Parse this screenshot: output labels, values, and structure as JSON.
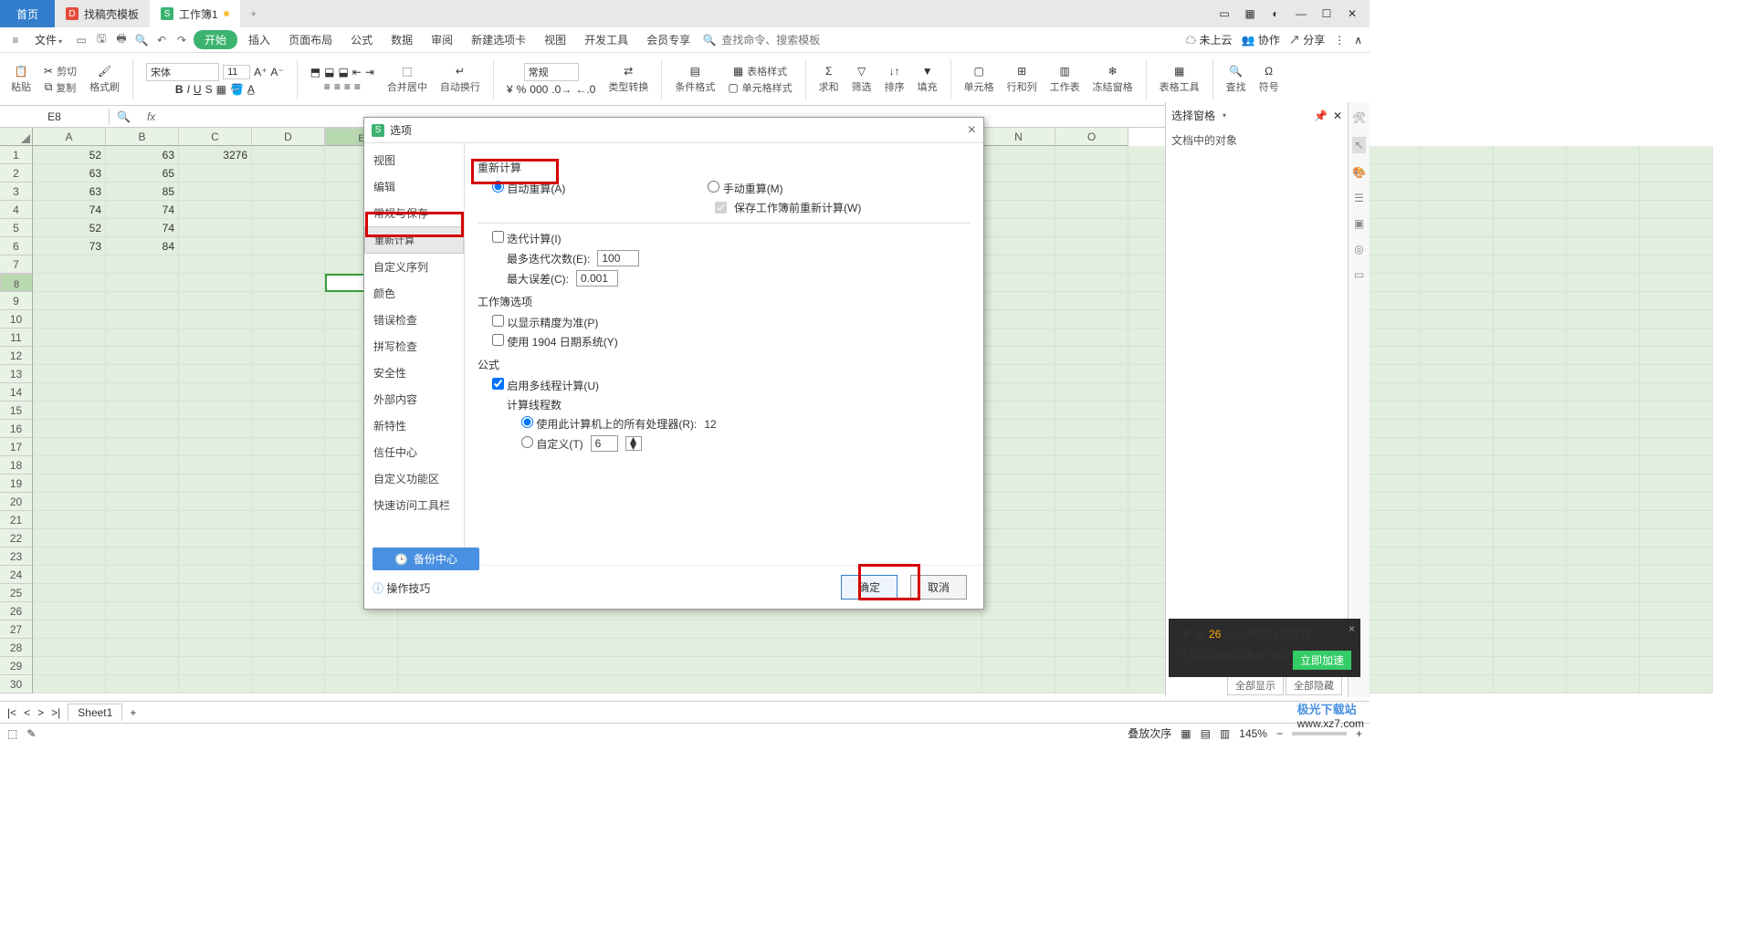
{
  "tabs": {
    "home": "首页",
    "templates": "找稿壳模板",
    "workbook": "工作簿1"
  },
  "menu": {
    "file": "文件",
    "start": "开始",
    "insert": "插入",
    "layout": "页面布局",
    "formula": "公式",
    "data": "数据",
    "review": "审阅",
    "newtab": "新建选项卡",
    "view": "视图",
    "dev": "开发工具",
    "member": "会员专享",
    "search_ph": "查找命令、搜索模板"
  },
  "topright": {
    "cloud": "未上云",
    "collab": "协作",
    "share": "分享"
  },
  "ribbon": {
    "paste": "粘贴",
    "cut": "剪切",
    "copy": "复制",
    "format": "格式刷",
    "font": "宋体",
    "size": "11",
    "merge": "合并居中",
    "wrap": "自动换行",
    "general": "常规",
    "convert": "类型转换",
    "cond": "条件格式",
    "tablestyle": "表格样式",
    "cellstyle": "单元格样式",
    "sum": "求和",
    "filter": "筛选",
    "sort": "排序",
    "fill": "填充",
    "cell": "单元格",
    "rowcol": "行和列",
    "worksheet": "工作表",
    "freeze": "冻结窗格",
    "tabletool": "表格工具",
    "find": "查找",
    "symbol": "符号"
  },
  "namebox": "E8",
  "fx": "fx",
  "cols": [
    "A",
    "B",
    "C",
    "D",
    "E",
    "N",
    "O"
  ],
  "cells": {
    "a": [
      "52",
      "63",
      "63",
      "74",
      "52",
      "73"
    ],
    "b": [
      "63",
      "65",
      "85",
      "74",
      "74",
      "84"
    ],
    "c1": "3276"
  },
  "dialog": {
    "title": "选项",
    "nav": [
      "视图",
      "编辑",
      "常规与保存",
      "重新计算",
      "自定义序列",
      "颜色",
      "错误检查",
      "拼写检查",
      "安全性",
      "外部内容",
      "新特性",
      "信任中心",
      "自定义功能区",
      "快速访问工具栏"
    ],
    "sect_recalc": "重新计算",
    "auto": "自动重算(A)",
    "manual": "手动重算(M)",
    "save_recalc": "保存工作簿前重新计算(W)",
    "iter": "迭代计算(I)",
    "max_iter_l": "最多迭代次数(E):",
    "max_iter_v": "100",
    "max_diff_l": "最大误差(C):",
    "max_diff_v": "0.001",
    "sect_wb": "工作簿选项",
    "precision": "以显示精度为准(P)",
    "date1904": "使用 1904 日期系统(Y)",
    "sect_formula": "公式",
    "multithread": "启用多线程计算(U)",
    "threads_l": "计算线程数",
    "use_all": "使用此计算机上的所有处理器(R):",
    "cpu_n": "12",
    "custom": "自定义(T)",
    "custom_v": "6",
    "backup": "备份中心",
    "tips": "操作技巧",
    "ok": "确定",
    "cancel": "取消"
  },
  "rpanel": {
    "title": "选择窗格",
    "objs": "文档中的对象",
    "showall": "全部显示",
    "hideall": "全部隐藏",
    "layers": "叠放次序"
  },
  "sheet": {
    "name": "Sheet1"
  },
  "status": {
    "zoom": "145%"
  },
  "toast": {
    "line1a": "有 ",
    "num": "26",
    "line1b": " 个无用的残留进程",
    "line2": "立即加速释放电脑内存",
    "btn": "立即加速"
  },
  "watermark": {
    "name": "极光下载站",
    "url": "www.xz7.com"
  }
}
